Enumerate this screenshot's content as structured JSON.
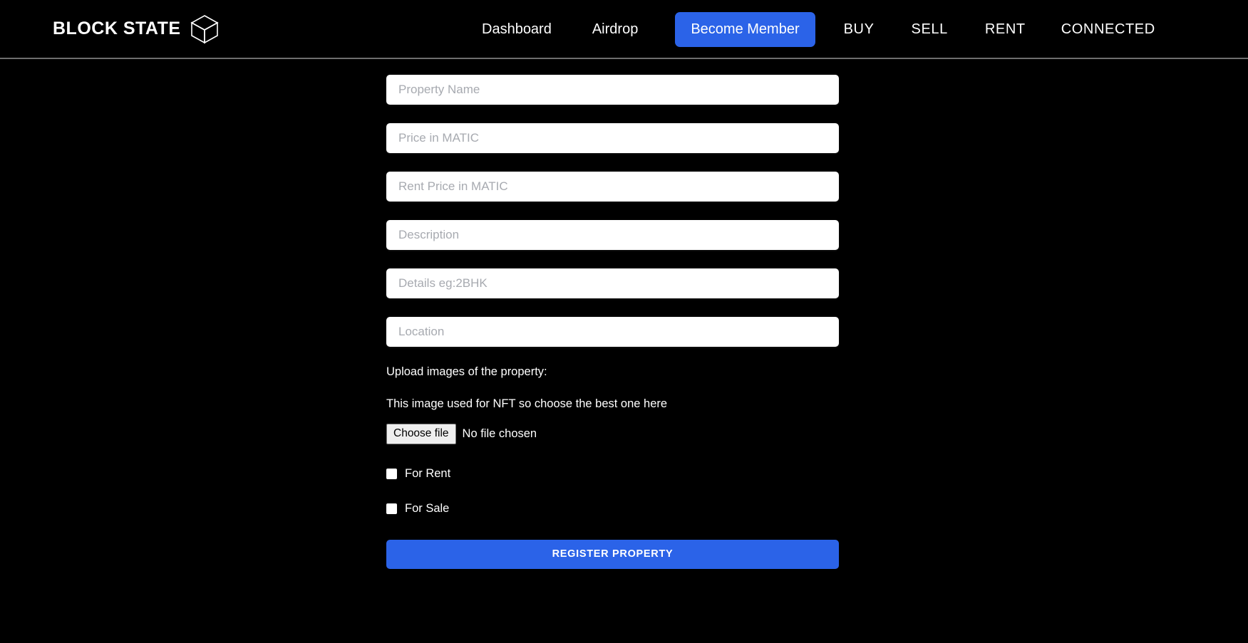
{
  "brand": {
    "name": "BLOCK STATE",
    "logo_icon": "cube-icon"
  },
  "nav": {
    "items": [
      {
        "label": "Dashboard",
        "style": "link"
      },
      {
        "label": "Airdrop",
        "style": "link"
      },
      {
        "label": "Become Member",
        "style": "button-primary"
      },
      {
        "label": "BUY",
        "style": "link-caps"
      },
      {
        "label": "SELL",
        "style": "link-caps"
      },
      {
        "label": "RENT",
        "style": "link-caps"
      },
      {
        "label": "CONNECTED",
        "style": "link-caps"
      }
    ]
  },
  "form": {
    "fields": [
      {
        "name": "property-name",
        "placeholder": "Property Name",
        "value": ""
      },
      {
        "name": "price-matic",
        "placeholder": "Price in MATIC",
        "value": ""
      },
      {
        "name": "rent-price-matic",
        "placeholder": "Rent Price in MATIC",
        "value": ""
      },
      {
        "name": "description",
        "placeholder": "Description",
        "value": ""
      },
      {
        "name": "details",
        "placeholder": "Details eg:2BHK",
        "value": ""
      },
      {
        "name": "location",
        "placeholder": "Location",
        "value": ""
      }
    ],
    "upload": {
      "label": "Upload images of the property:",
      "note": "This image used for NFT so choose the best one here",
      "choose_button": "Choose file",
      "file_status": "No file chosen"
    },
    "checkboxes": [
      {
        "name": "for-rent",
        "label": "For Rent",
        "checked": false
      },
      {
        "name": "for-sale",
        "label": "For Sale",
        "checked": false
      }
    ],
    "submit_label": "REGISTER PROPERTY"
  },
  "colors": {
    "background": "#000000",
    "accent": "#2b63e8",
    "field_background": "#ffffff",
    "placeholder": "#a7aab0",
    "text": "#ffffff",
    "divider": "#6e6e6e"
  }
}
